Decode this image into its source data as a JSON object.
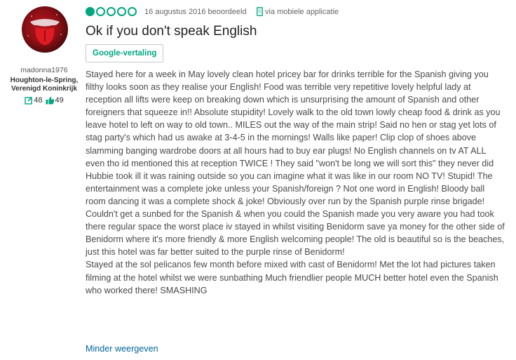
{
  "reviewer": {
    "username": "madonna1976",
    "location_line1": "Houghton-le-Spring,",
    "location_line2": "Verenigd Koninkrijk",
    "reviews_count": "48",
    "helpful_votes": "49"
  },
  "review": {
    "rating": 1,
    "rating_max": 5,
    "date": "16 augustus 2016 beoordeeld",
    "via": "via mobiele applicatie",
    "title": "Ok if you don't speak English",
    "translate_button": "Google-vertaling",
    "paragraph1": "Stayed here for a week in May lovely clean hotel pricey bar for drinks terrible for the Spanish giving you filthy looks soon as they realise your English! Food was terrible very repetitive lovely helpful lady at reception all lifts were keep on breaking down which is unsurprising the amount of Spanish and other foreigners that squeeze in!! Absolute stupidity! Lovely walk to the old town lowly cheap food & drink as you leave hotel to left on way to old town.. MILES out the way of the main strip! Said no hen or stag yet lots of stag party's which had us awake at 3-4-5 in the mornings! Walls like paper! Clip clop of shoes above slamming banging wardrobe doors at all hours had to buy ear plugs! No English channels on tv AT ALL even tho id mentioned this at reception TWICE ! They said \"won't be long we will sort this\" they never did Hubbie took ill it was raining outside so you can imagine what it was like in our room NO TV! Stupid! The entertainment was a complete joke unless your Spanish/foreign ? Not one word in English! Bloody ball room dancing it was a complete shock & joke! Obviously over run by the Spanish purple rinse brigade! Couldn't get a sunbed for the Spanish & when you could the Spanish made you very aware you had took there regular space the worst place iv stayed in whilst visiting Benidorm save ya money for the other side of Benidorm where it's more friendly & more English welcoming people! The old is beautiful so is the beaches, just this hotel was far better suited to the purple rinse of Benidorm!",
    "paragraph2": "Stayed at the sol pelicanos few month before mixed with cast of Benidorm! Met the lot had pictures taken filming at the hotel whilst we were sunbathing Much friendlier people MUCH better hotel even the Spanish who worked there! SMASHING",
    "show_less": "Minder weergeven"
  },
  "icons": {
    "avatar": "rolling-stones-tongue-avatar",
    "reviews": "review-pencil-icon",
    "helpful": "thumbs-up-icon",
    "mobile": "mobile-phone-icon"
  },
  "colors": {
    "rating_green": "#00a680",
    "link_blue": "#006699",
    "title": "#222222",
    "body_text": "#4a4a4a"
  }
}
